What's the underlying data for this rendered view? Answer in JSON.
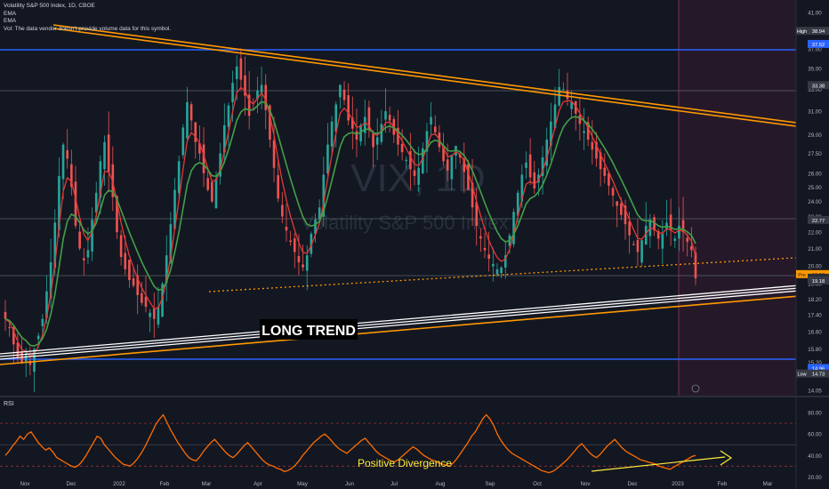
{
  "header": {
    "symbol_line": "Volatility S&P 500 Index, 1D, CBOE",
    "ema1_label": "EMA",
    "ema2_label": "EMA",
    "vol_note": "Vol: The data vendor doesn't provide volume data for this symbol."
  },
  "watermark": {
    "ticker": "VIX, 1D",
    "name": "Volatility S&P 500 Index"
  },
  "annotations": {
    "long_trend": "LONG TREND",
    "positive_divergence": "Positive Divergence"
  },
  "rsi_label": "RSI",
  "colors": {
    "background": "#131722",
    "bull": "#26a69a",
    "bear": "#ef5350",
    "ema_fast": "#e53935",
    "ema_slow": "#43a047",
    "trend_orange": "#ff9800",
    "level_blue": "#2962ff",
    "rsi_line": "#ff6d00",
    "divergence": "#ffeb3b"
  },
  "chart_data": [
    {
      "type": "candlestick",
      "title": "Volatility S&P 500 Index, 1D, CBOE",
      "x_ticks": [
        "Nov",
        "Dec",
        "2022",
        "Feb",
        "Mar",
        "Apr",
        "May",
        "Jun",
        "Jul",
        "Aug",
        "Sep",
        "Oct",
        "Nov",
        "Dec",
        "2023",
        "Feb",
        "Mar"
      ],
      "y_ticks": [
        14.05,
        14.7,
        15.2,
        15.8,
        16.6,
        17.4,
        18.2,
        19.0,
        20.0,
        21.0,
        22.0,
        23.0,
        24.0,
        25.0,
        26.0,
        27.5,
        29.0,
        31.0,
        33.0,
        35.0,
        37.0,
        39.0,
        41.0
      ],
      "y_range": [
        13.8,
        42.5
      ],
      "scale": "log",
      "price_labels": [
        {
          "label": "High",
          "value": 38.94
        },
        {
          "label": "",
          "value": 37.52
        },
        {
          "label": "",
          "value": 33.38
        },
        {
          "label": "",
          "value": 22.77
        },
        {
          "label": "Pre",
          "value": 19.53
        },
        {
          "label": "",
          "value": 19.33
        },
        {
          "label": "",
          "value": 19.18
        },
        {
          "label": "",
          "value": 14.96
        },
        {
          "label": "Low",
          "value": 14.73
        }
      ],
      "horizontal_levels": [
        37.52,
        14.96,
        33.38,
        22.77,
        19.18
      ],
      "ohlc_close_series_approx": [
        17.2,
        16.8,
        16.0,
        15.4,
        15.2,
        15.6,
        15.1,
        15.8,
        16.4,
        17.2,
        18.6,
        20.2,
        22.6,
        25.8,
        28.2,
        27.1,
        25.0,
        22.4,
        21.0,
        20.3,
        20.9,
        22.8,
        24.6,
        26.9,
        28.4,
        26.1,
        24.3,
        22.0,
        20.5,
        19.8,
        19.2,
        18.9,
        18.4,
        18.0,
        17.8,
        17.5,
        17.2,
        17.8,
        19.0,
        20.6,
        22.5,
        24.8,
        26.9,
        29.6,
        31.8,
        30.2,
        28.4,
        27.5,
        26.0,
        24.8,
        24.0,
        25.6,
        27.5,
        29.8,
        31.5,
        33.6,
        35.2,
        33.9,
        32.4,
        30.6,
        31.2,
        32.9,
        33.4,
        31.1,
        28.6,
        26.4,
        24.2,
        23.0,
        22.1,
        21.4,
        20.8,
        20.2,
        19.9,
        20.6,
        21.9,
        22.8,
        23.6,
        25.9,
        28.2,
        30.1,
        31.6,
        33.4,
        32.0,
        30.2,
        29.5,
        28.6,
        29.8,
        30.5,
        29.4,
        28.0,
        28.8,
        29.9,
        31.0,
        30.2,
        29.0,
        28.2,
        27.6,
        27.0,
        26.3,
        25.8,
        26.4,
        27.9,
        29.3,
        30.5,
        29.2,
        28.0,
        26.9,
        26.2,
        27.4,
        28.1,
        27.2,
        26.1,
        24.8,
        23.6,
        22.4,
        21.6,
        20.9,
        20.4,
        20.1,
        19.8,
        19.9,
        20.6,
        21.8,
        23.3,
        24.6,
        25.9,
        26.8,
        25.7,
        24.9,
        25.9,
        27.2,
        28.6,
        30.1,
        31.6,
        33.2,
        33.0,
        32.1,
        31.8,
        30.8,
        29.9,
        29.3,
        28.6,
        27.8,
        27.1,
        26.3,
        25.8,
        25.1,
        24.4,
        23.7,
        23.1,
        22.5,
        21.8,
        21.2,
        20.8,
        21.5,
        22.4,
        22.8,
        22.1,
        21.6,
        21.9,
        22.6,
        22.1,
        21.6,
        22.4,
        22.0,
        21.4,
        20.9,
        19.3
      ],
      "series": [
        {
          "name": "EMA",
          "color": "#e53935"
        },
        {
          "name": "EMA",
          "color": "#43a047"
        }
      ]
    },
    {
      "type": "line",
      "title": "RSI",
      "y_ticks": [
        20.0,
        40.0,
        60.0,
        80.0
      ],
      "y_range": [
        17,
        90
      ],
      "bands": [
        30,
        70
      ],
      "values": [
        40,
        44,
        49,
        53,
        58,
        55,
        60,
        62,
        57,
        52,
        48,
        45,
        47,
        43,
        38,
        36,
        34,
        32,
        30,
        29,
        31,
        35,
        40,
        46,
        52,
        58,
        56,
        50,
        46,
        42,
        38,
        35,
        32,
        31,
        30,
        33,
        37,
        42,
        48,
        55,
        62,
        69,
        74,
        78,
        71,
        64,
        58,
        52,
        47,
        42,
        38,
        36,
        35,
        39,
        44,
        48,
        52,
        55,
        51,
        47,
        43,
        40,
        38,
        41,
        45,
        49,
        52,
        48,
        44,
        40,
        36,
        33,
        31,
        30,
        28,
        27,
        25,
        26,
        28,
        31,
        35,
        40,
        44,
        48,
        52,
        55,
        58,
        60,
        57,
        53,
        49,
        46,
        44,
        42,
        45,
        48,
        51,
        54,
        56,
        52,
        48,
        44,
        41,
        39,
        37,
        35,
        34,
        36,
        39,
        42,
        45,
        48,
        46,
        43,
        40,
        38,
        36,
        35,
        33,
        32,
        31,
        30,
        33,
        37,
        42,
        47,
        52,
        58,
        62,
        68,
        74,
        78,
        74,
        68,
        60,
        54,
        49,
        45,
        42,
        40,
        38,
        36,
        34,
        32,
        30,
        28,
        26,
        25,
        24,
        25,
        27,
        30,
        33,
        36,
        40,
        44,
        48,
        51,
        47,
        43,
        40,
        38,
        41,
        45,
        49,
        52,
        55,
        51,
        47,
        44,
        42,
        40,
        38,
        36,
        35,
        34,
        33,
        32,
        30,
        29,
        28,
        27,
        29,
        31,
        33,
        35,
        37,
        39,
        40
      ],
      "annotation": "Positive Divergence"
    }
  ]
}
